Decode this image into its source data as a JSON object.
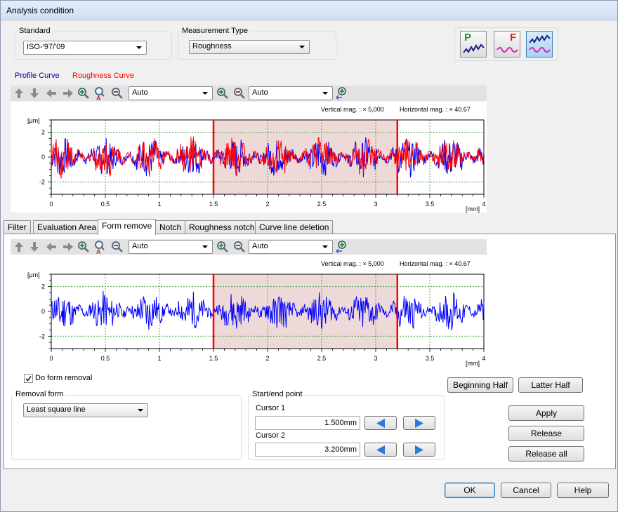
{
  "window": {
    "title": "Analysis condition"
  },
  "standard": {
    "label": "Standard",
    "value": "ISO-'97/'09"
  },
  "measurement_type": {
    "label": "Measurement Type",
    "value": "Roughness"
  },
  "mode_buttons": [
    {
      "letter": "P",
      "icon": "profile-wave-icon"
    },
    {
      "letter": "F",
      "icon": "filtered-wave-icon"
    },
    {
      "letter": "",
      "icon": "roughness-wave-icon"
    }
  ],
  "legend": {
    "profile": "Profile Curve",
    "roughness": "Roughness Curve",
    "profile_color": "#0000ff",
    "roughness_color": "#ff0000"
  },
  "toolbar": {
    "scale1": "Auto",
    "scale2": "Auto"
  },
  "plot_info": {
    "vertical": "Vertical mag. : × 5,000",
    "horizontal": "Horizontal mag. : × 40.67"
  },
  "chart_data": [
    {
      "type": "line",
      "title": "",
      "ylabel": "[μm]",
      "xlabel": "[mm]",
      "xlim": [
        0,
        4
      ],
      "ylim": [
        -3,
        3
      ],
      "x_ticks": [
        "0",
        "0.5",
        "1",
        "1.5",
        "2",
        "2.5",
        "3",
        "3.5",
        "4"
      ],
      "y_ticks": [
        "2",
        "0",
        "-2"
      ],
      "grid": true,
      "cursor_range": [
        1.5,
        3.2
      ],
      "series": [
        {
          "name": "Profile Curve",
          "color": "#0000ff",
          "amplitude": 1.5,
          "seed": 7
        },
        {
          "name": "Roughness Curve",
          "color": "#ff0000",
          "amplitude": 1.5,
          "seed": 7
        }
      ]
    },
    {
      "type": "line",
      "title": "",
      "ylabel": "[μm]",
      "xlabel": "[mm]",
      "xlim": [
        0,
        4
      ],
      "ylim": [
        -3,
        3
      ],
      "x_ticks": [
        "0",
        "0.5",
        "1",
        "1.5",
        "2",
        "2.5",
        "3",
        "3.5",
        "4"
      ],
      "y_ticks": [
        "2",
        "0",
        "-2"
      ],
      "grid": true,
      "cursor_range": [
        1.5,
        3.2
      ],
      "series": [
        {
          "name": "Profile Curve",
          "color": "#0000ff",
          "amplitude": 1.5,
          "seed": 11
        }
      ]
    }
  ],
  "tabs": [
    "Filter",
    "Evaluation Area",
    "Form remove",
    "Notch",
    "Roughness notch",
    "Curve line deletion"
  ],
  "form": {
    "do_form_removal": "Do form removal",
    "removal_form_label": "Removal form",
    "removal_form_value": "Least square line",
    "start_end_label": "Start/end point",
    "cursor1_label": "Cursor 1",
    "cursor1_value": "1.500mm",
    "cursor2_label": "Cursor 2",
    "cursor2_value": "3.200mm",
    "beginning_half": "Beginning Half",
    "latter_half": "Latter Half",
    "apply": "Apply",
    "release": "Release",
    "release_all": "Release all"
  },
  "footer": {
    "ok": "OK",
    "cancel": "Cancel",
    "help": "Help"
  }
}
